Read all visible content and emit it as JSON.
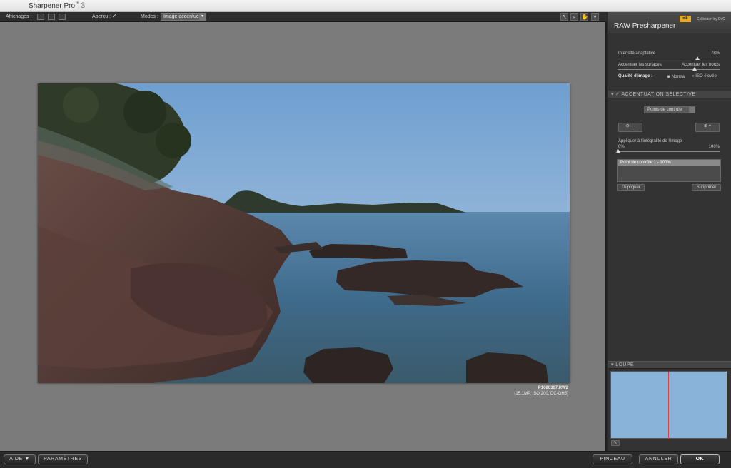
{
  "app": {
    "title": "Sharpener Pro",
    "trademark": "™",
    "version": "3"
  },
  "toolbar": {
    "affichages_label": "Affichages :",
    "apercu_label": "Aperçu :",
    "apercu_checked": "✓",
    "modes_label": "Modes :",
    "mode_value": "Image accentuée"
  },
  "photo": {
    "filename": "P1080367.RW2",
    "meta": "(15.1MP, ISO 200, DC-GH5)"
  },
  "panel": {
    "title": "RAW Presharpener",
    "brand_badge": "nik",
    "collection": "Collection by DxO",
    "intensity_label": "Intensité adaptative",
    "intensity_value": "78%",
    "intensity_level": 0.78,
    "surfaces_label": "Accentuer les surfaces",
    "bords_label": "Accentuer les bords",
    "quality_label": "Qualité d'image :",
    "quality_normal": "Normal",
    "quality_iso": "ISO élevée",
    "section_selective": "ACCENTUATION SÉLECTIVE",
    "control_points_select": "Points de contrôle",
    "apply_label": "Appliquer à l'intégralité de l'image",
    "apply_min": "0%",
    "apply_max": "100%",
    "apply_level": 0.0,
    "cp_item": "Point de contrôle 1 - 100%",
    "duplicate_button": "Dupliquer",
    "delete_button": "Supprimer",
    "loupe_label": "LOUPE"
  },
  "bottom": {
    "help": "AIDE ▼",
    "settings": "PARAMÈTRES",
    "brush": "PINCEAU",
    "cancel": "ANNULER",
    "ok": "OK"
  },
  "colors": {
    "canvas": "#7b7b7b",
    "panel": "#333333",
    "sky": "#8ab3d9",
    "accent_badge": "#e3a922"
  }
}
